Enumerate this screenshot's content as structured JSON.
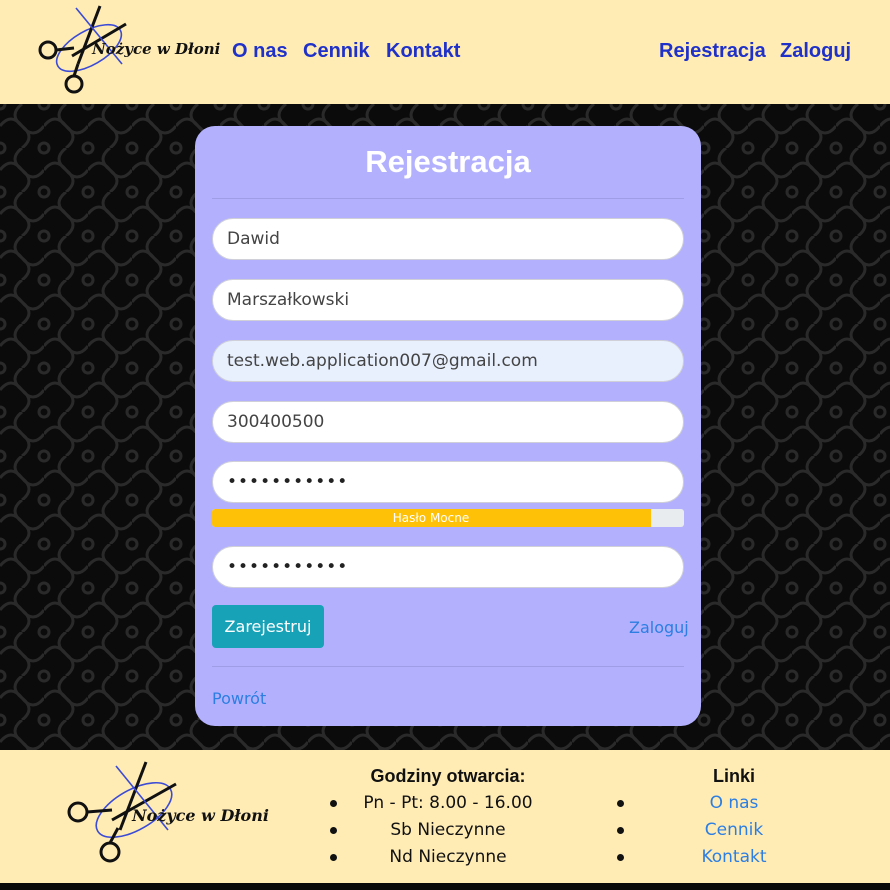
{
  "header": {
    "logo_text": "Nożyce w Dłoni",
    "nav_left": [
      "O nas",
      "Cennik",
      "Kontakt"
    ],
    "nav_right": [
      "Rejestracja",
      "Zaloguj"
    ]
  },
  "form": {
    "title": "Rejestracja",
    "first_name": "Dawid",
    "last_name": "Marszałkowski",
    "email": "test.web.application007@gmail.com",
    "phone": "300400500",
    "password": "•••••••••••",
    "password_confirm": "•••••••••••",
    "strength_label": "Hasło Mocne",
    "strength_percent": 93,
    "submit_label": "Zarejestruj",
    "login_link": "Zaloguj",
    "back_link": "Powrót"
  },
  "footer": {
    "logo_text": "Nożyce w Dłoni",
    "hours_heading": "Godziny otwarcia:",
    "hours": [
      "Pn - Pt: 8.00 - 16.00",
      "Sb Nieczynne",
      "Nd Nieczynne"
    ],
    "links_heading": "Linki",
    "links": [
      "O nas",
      "Cennik",
      "Kontakt"
    ]
  },
  "colors": {
    "header_bg": "#ffecb5",
    "card_bg": "#b3b1fd",
    "nav_link": "#1f31c9",
    "link": "#2c7ee3",
    "button": "#17a2b8",
    "strength": "#ffc107"
  }
}
